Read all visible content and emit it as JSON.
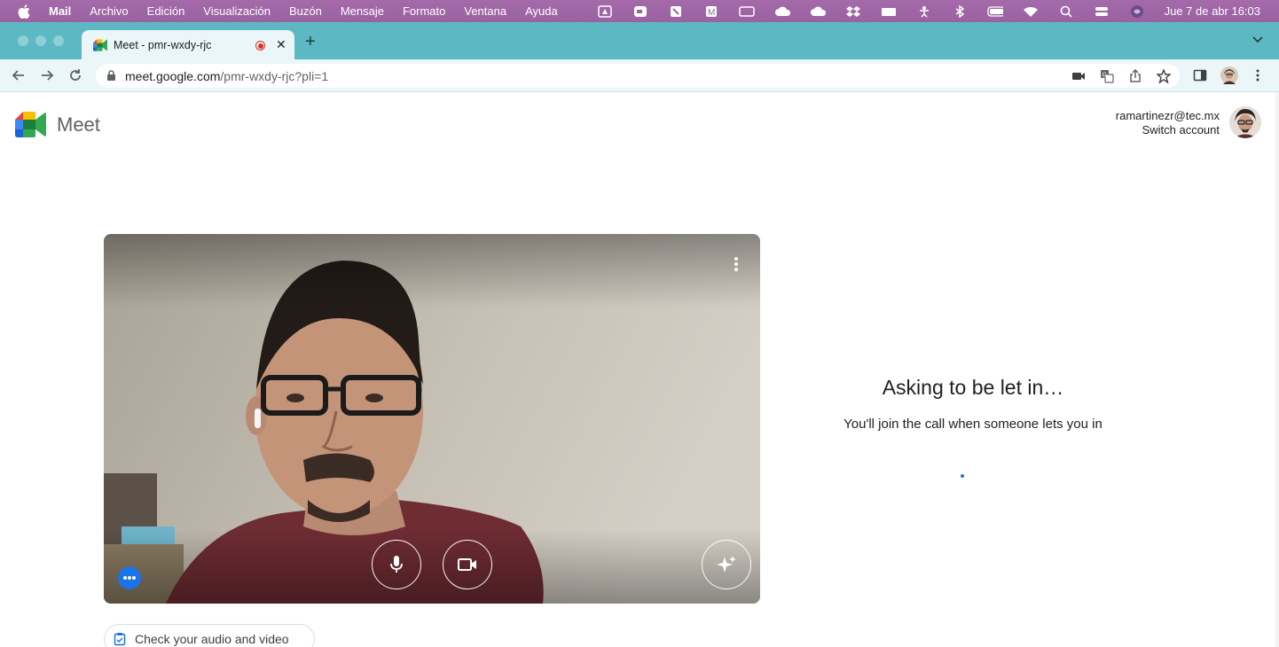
{
  "menubar": {
    "app": "Mail",
    "items": [
      "Archivo",
      "Edición",
      "Visualización",
      "Buzón",
      "Mensaje",
      "Formato",
      "Ventana",
      "Ayuda"
    ],
    "clock": "Jue 7 de abr  16:03"
  },
  "browser": {
    "tab_title": "Meet - pmr-wxdy-rjc",
    "url_host": "meet.google.com",
    "url_path": "/pmr-wxdy-rjc?pli=1"
  },
  "meet": {
    "brand": "Meet",
    "account_email": "ramartinezr@tec.mx",
    "switch_account": "Switch account",
    "status_title": "Asking to be let in…",
    "status_subtitle": "You'll join the call when someone lets you in",
    "check_av_label": "Check your audio and video"
  },
  "colors": {
    "menubar": "#9a62a2",
    "tabstrip": "#5cb8c2",
    "toolbar": "#eaf6f8",
    "accent": "#1a73e8"
  }
}
